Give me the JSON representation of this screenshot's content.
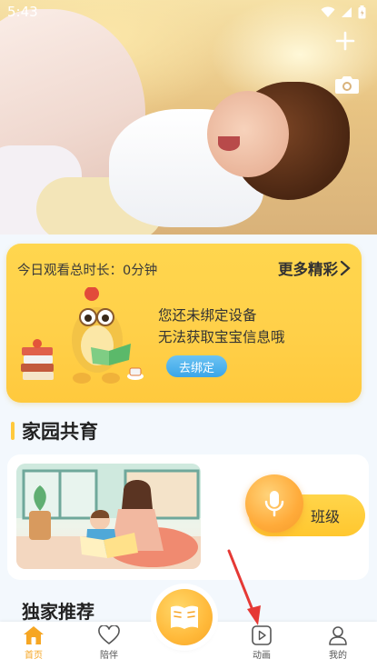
{
  "status_bar": {
    "time": "5:43"
  },
  "watch_card": {
    "watch_time": "今日观看总时长：0分钟",
    "more": "更多精彩",
    "unbound_line1": "您还未绑定设备",
    "unbound_line2": "无法获取宝宝信息哦",
    "bind_button": "去绑定"
  },
  "section": {
    "title": "家园共育",
    "class_button": "班级"
  },
  "exclusive": {
    "title": "独家推荐"
  },
  "bottom_nav": {
    "home": "首页",
    "companion": "陪伴",
    "animation": "动画",
    "mine": "我的"
  },
  "colors": {
    "accent": "#ffc93d",
    "active_nav": "#f6a623",
    "bind_button": "#3ba6e8",
    "arrow": "#e53935"
  },
  "icons": [
    "plus-icon",
    "camera-icon",
    "chevron-right-icon",
    "microphone-icon",
    "book-icon",
    "home-icon",
    "heart-icon",
    "play-icon",
    "user-icon",
    "wifi-icon",
    "signal-icon",
    "battery-icon"
  ]
}
